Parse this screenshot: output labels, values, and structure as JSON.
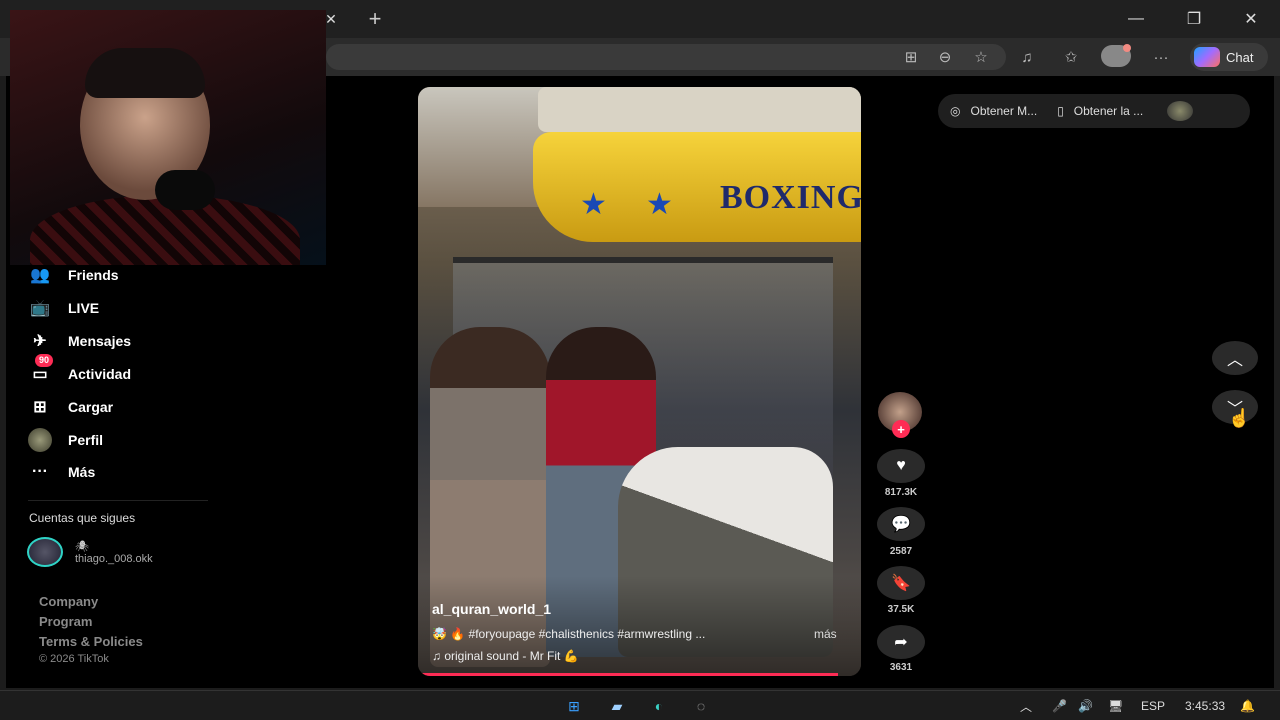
{
  "browser": {
    "new_tab_label": "+",
    "chat_label": "Chat",
    "tab_close": "✕",
    "minimize": "—",
    "restore": "❐",
    "close": "✕"
  },
  "sidebar": {
    "items": [
      {
        "label": "Friends",
        "icon": "friends-icon",
        "glyph": "👥"
      },
      {
        "label": "LIVE",
        "icon": "live-icon",
        "glyph": "📺"
      },
      {
        "label": "Mensajes",
        "icon": "messages-icon",
        "glyph": "✈"
      },
      {
        "label": "Actividad",
        "icon": "activity-icon",
        "glyph": "▭",
        "badge": "90"
      },
      {
        "label": "Cargar",
        "icon": "upload-icon",
        "glyph": "⊞"
      },
      {
        "label": "Perfil",
        "icon": "profile-avatar",
        "glyph": ""
      },
      {
        "label": "Más",
        "icon": "more-icon",
        "glyph": "···"
      }
    ],
    "following_title": "Cuentas que sigues",
    "following": [
      {
        "emoji": "🕷",
        "name": "thiago._008.okk"
      }
    ],
    "footer": [
      "Company",
      "Program",
      "Terms & Policies"
    ],
    "copyright": "© 2026 TikTok"
  },
  "video": {
    "sign_text": "BOXING",
    "username": "al_quran_world_1",
    "description": "🤯 🔥 #foryoupage #chalisthenics #armwrestling ...",
    "more_label": "más",
    "sound": "♫  original sound - Mr Fit 💪"
  },
  "actions": {
    "likes": "817.3K",
    "comments": "2587",
    "saves": "37.5K",
    "shares": "3631"
  },
  "extensions": {
    "item1": "Obtener M...",
    "item2": "Obtener la ..."
  },
  "taskbar": {
    "language": "ESP",
    "time": "3:45:33"
  },
  "colors": {
    "accent": "#fe2c55",
    "copilot_gradient": [
      "#1fa2ff",
      "#a16cff",
      "#ff6f61"
    ]
  }
}
